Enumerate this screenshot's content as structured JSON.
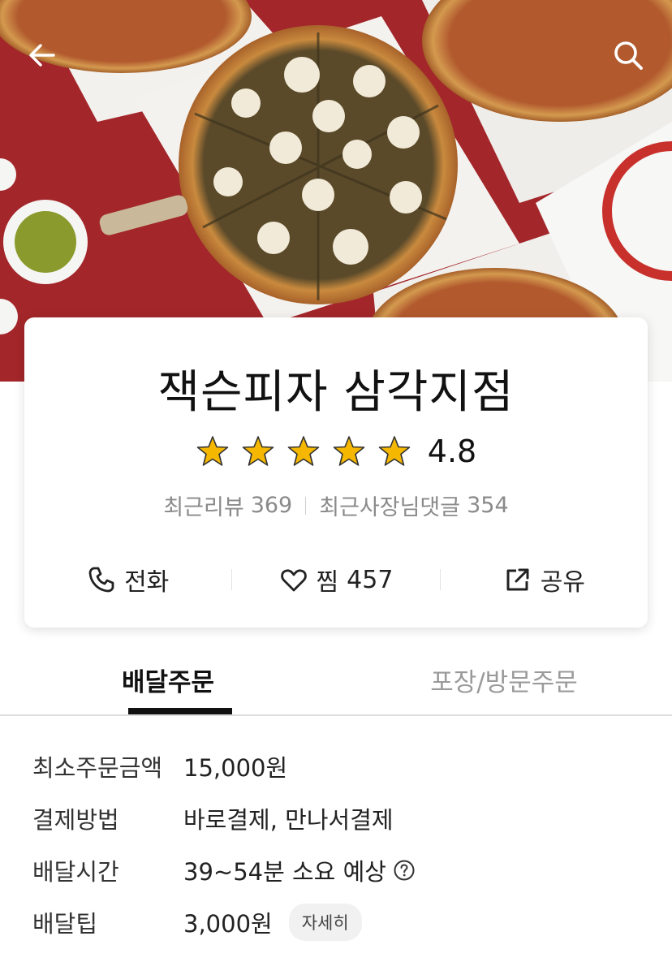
{
  "nav": {
    "back_icon": "arrow-left-icon",
    "search_icon": "search-icon"
  },
  "store": {
    "name": "잭슨피자 삼각지점",
    "rating": "4.8",
    "star_count": 5,
    "star_color": "#f5b700",
    "recent_reviews_label": "최근리뷰",
    "recent_reviews_count": "369",
    "owner_replies_label": "최근사장님댓글",
    "owner_replies_count": "354"
  },
  "actions": {
    "call_label": "전화",
    "call_icon": "phone-icon",
    "like_label": "찜",
    "like_count": "457",
    "like_icon": "heart-icon",
    "share_label": "공유",
    "share_icon": "share-icon"
  },
  "tabs": {
    "delivery": "배달주문",
    "pickup": "포장/방문주문"
  },
  "info": {
    "min_order_label": "최소주문금액",
    "min_order_value": "15,000원",
    "payment_label": "결제방법",
    "payment_value": "바로결제, 만나서결제",
    "delivery_time_label": "배달시간",
    "delivery_time_value": "39~54분 소요 예상",
    "delivery_tip_label": "배달팁",
    "delivery_tip_value": "3,000원",
    "detail_button": "자세히"
  },
  "colors": {
    "hero_background": "#a3262a",
    "text_primary": "#111111",
    "text_secondary": "#8a8a8a"
  }
}
